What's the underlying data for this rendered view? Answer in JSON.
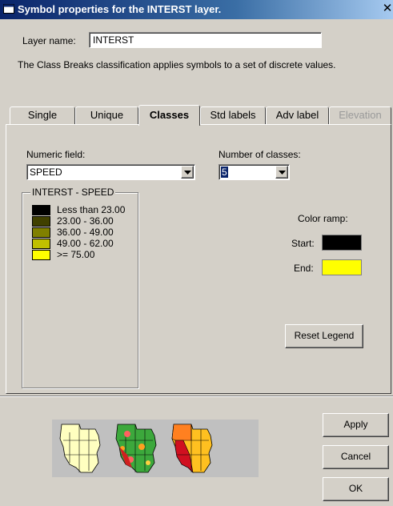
{
  "window": {
    "title": "Symbol properties for the INTERST layer.",
    "close_glyph": "✕"
  },
  "layer": {
    "label": "Layer name:",
    "value": "INTERST"
  },
  "description": "The Class Breaks classification applies symbols to a set of discrete values.",
  "tabs": [
    {
      "label": "Single",
      "state": "normal"
    },
    {
      "label": "Unique",
      "state": "normal"
    },
    {
      "label": "Classes",
      "state": "active"
    },
    {
      "label": "Std labels",
      "state": "normal"
    },
    {
      "label": "Adv label",
      "state": "normal"
    },
    {
      "label": "Elevation",
      "state": "disabled"
    }
  ],
  "classes_panel": {
    "numeric_field_label": "Numeric field:",
    "numeric_field_value": "SPEED",
    "num_classes_label": "Number of classes:",
    "num_classes_value": "5",
    "legend_title": "INTERST - SPEED",
    "legend": [
      {
        "label": "Less than 23.00",
        "color": "#000000"
      },
      {
        "label": "23.00 - 36.00",
        "color": "#404000"
      },
      {
        "label": "36.00 - 49.00",
        "color": "#808000"
      },
      {
        "label": "49.00 - 62.00",
        "color": "#c0c000"
      },
      {
        "label": ">= 75.00",
        "color": "#ffff00"
      }
    ],
    "color_ramp_label": "Color ramp:",
    "start_label": "Start:",
    "start_color": "#000000",
    "end_label": "End:",
    "end_color": "#ffff00",
    "reset_button": "Reset Legend"
  },
  "buttons": {
    "apply": "Apply",
    "cancel": "Cancel",
    "ok": "OK"
  },
  "preview_icons": [
    "single-symbol-map-icon",
    "unique-values-map-icon",
    "class-breaks-map-icon"
  ]
}
